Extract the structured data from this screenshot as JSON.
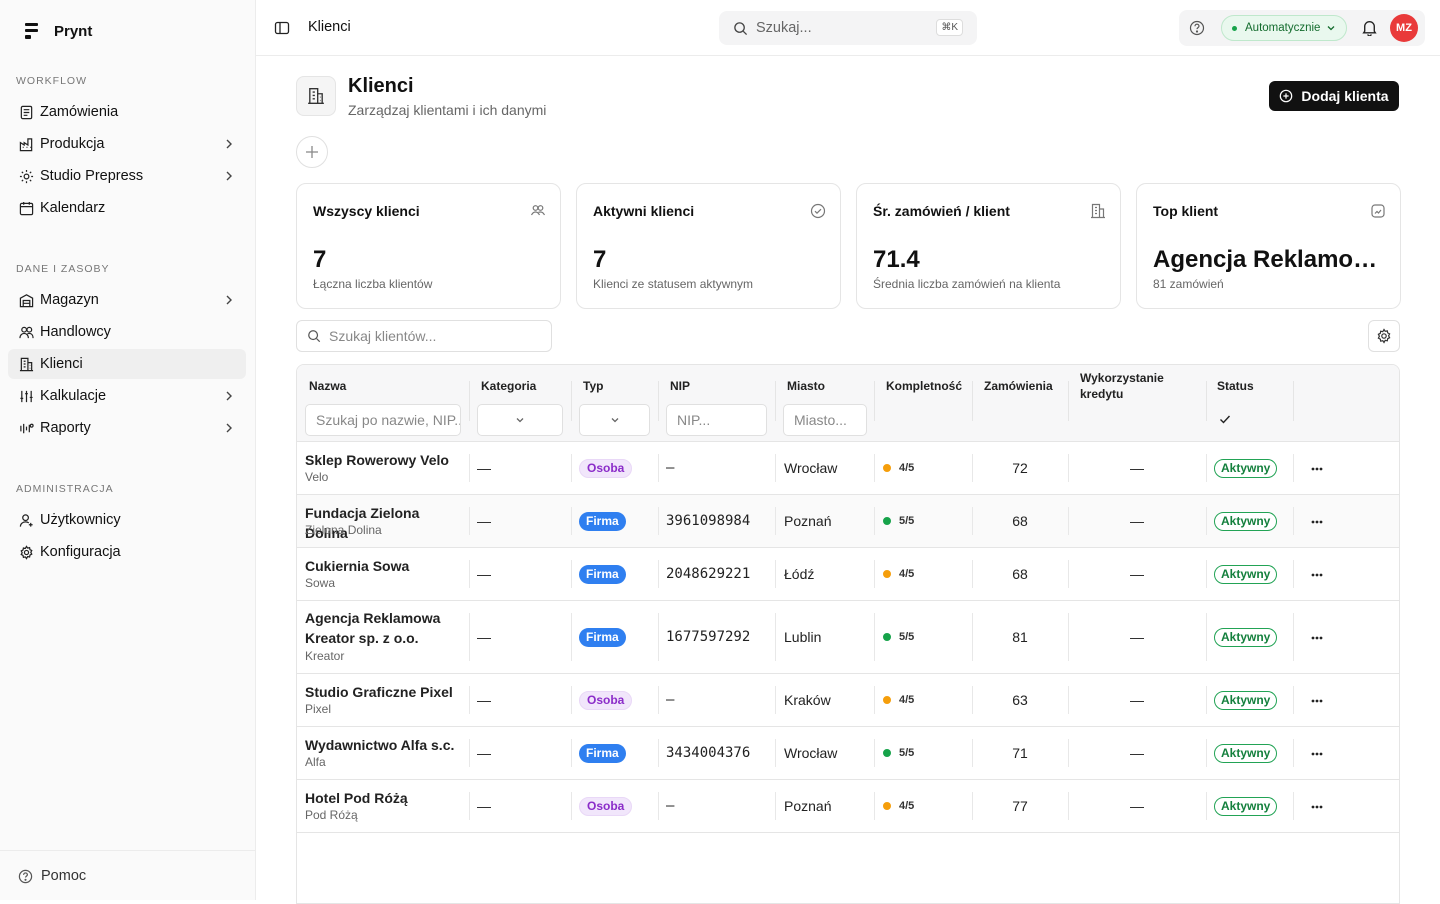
{
  "app": {
    "name": "Prynt"
  },
  "sidebar": {
    "sections": [
      {
        "label": "WORKFLOW",
        "items": [
          {
            "label": "Zamówienia",
            "icon": "orders-icon"
          },
          {
            "label": "Produkcja",
            "icon": "factory-icon",
            "chevron": true
          },
          {
            "label": "Studio Prepress",
            "icon": "studio-icon",
            "chevron": true
          },
          {
            "label": "Kalendarz",
            "icon": "calendar-icon"
          }
        ]
      },
      {
        "label": "DANE I ZASOBY",
        "items": [
          {
            "label": "Magazyn",
            "icon": "warehouse-icon",
            "chevron": true
          },
          {
            "label": "Handlowcy",
            "icon": "sales-icon"
          },
          {
            "label": "Klienci",
            "icon": "building-icon",
            "active": true
          },
          {
            "label": "Kalkulacje",
            "icon": "sliders-icon",
            "chevron": true
          },
          {
            "label": "Raporty",
            "icon": "reports-icon",
            "chevron": true
          }
        ]
      },
      {
        "label": "ADMINISTRACJA",
        "items": [
          {
            "label": "Użytkownicy",
            "icon": "user-icon"
          },
          {
            "label": "Konfiguracja",
            "icon": "gear-icon"
          }
        ]
      }
    ],
    "help": "Pomoc"
  },
  "topbar": {
    "title": "Klienci",
    "search_placeholder": "Szukaj...",
    "shortcut": "⌘K",
    "mode": "Automatycznie",
    "avatar": "MZ"
  },
  "page": {
    "title": "Klienci",
    "subtitle": "Zarządzaj klientami i ich danymi",
    "add_button": "Dodaj klienta"
  },
  "cards": [
    {
      "title": "Wszyscy klienci",
      "value": "7",
      "sub": "Łączna liczba klientów",
      "icon": "users-icon"
    },
    {
      "title": "Aktywni klienci",
      "value": "7",
      "sub": "Klienci ze statusem aktywnym",
      "icon": "check-circle-icon"
    },
    {
      "title": "Śr. zamówień / klient",
      "value": "71.4",
      "sub": "Średnia liczba zamówień na klienta",
      "icon": "building-icon"
    },
    {
      "title": "Top klient",
      "value": "Agencja Reklamowa Kreator sp. z o.o.",
      "sub": "81 zamówień",
      "icon": "chart-box-icon"
    }
  ],
  "table": {
    "search_placeholder": "Szukaj klientów...",
    "columns": {
      "name": "Nazwa",
      "category": "Kategoria",
      "type": "Typ",
      "nip": "NIP",
      "city": "Miasto",
      "completeness": "Kompletność",
      "orders": "Zamówienia",
      "credit": "Wykorzystanie kredytu",
      "status": "Status"
    },
    "filters": {
      "name": "Szukaj po nazwie, NIP...",
      "nip": "NIP...",
      "city": "Miasto..."
    },
    "rows": [
      {
        "name": "Sklep Rowerowy Velo",
        "short": "Velo",
        "category": "—",
        "type": "Osoba",
        "nip": "—",
        "city": "Wrocław",
        "completeness": "4/5",
        "comp_color": "#f59e0b",
        "orders": "72",
        "credit": "—",
        "status": "Aktywny"
      },
      {
        "name": "Fundacja Zielona Dolina",
        "short": "Zielona Dolina",
        "category": "—",
        "type": "Firma",
        "nip": "3961098984",
        "city": "Poznań",
        "completeness": "5/5",
        "comp_color": "#16a34a",
        "orders": "68",
        "credit": "—",
        "status": "Aktywny"
      },
      {
        "name": "Cukiernia Sowa",
        "short": "Sowa",
        "category": "—",
        "type": "Firma",
        "nip": "2048629221",
        "city": "Łódź",
        "completeness": "4/5",
        "comp_color": "#f59e0b",
        "orders": "68",
        "credit": "—",
        "status": "Aktywny"
      },
      {
        "name": "Agencja Reklamowa Kreator sp. z o.o.",
        "short": "Kreator",
        "category": "—",
        "type": "Firma",
        "nip": "1677597292",
        "city": "Lublin",
        "completeness": "5/5",
        "comp_color": "#16a34a",
        "orders": "81",
        "credit": "—",
        "status": "Aktywny"
      },
      {
        "name": "Studio Graficzne Pixel",
        "short": "Pixel",
        "category": "—",
        "type": "Osoba",
        "nip": "—",
        "city": "Kraków",
        "completeness": "4/5",
        "comp_color": "#f59e0b",
        "orders": "63",
        "credit": "—",
        "status": "Aktywny"
      },
      {
        "name": "Wydawnictwo Alfa s.c.",
        "short": "Alfa",
        "category": "—",
        "type": "Firma",
        "nip": "3434004376",
        "city": "Wrocław",
        "completeness": "5/5",
        "comp_color": "#16a34a",
        "orders": "71",
        "credit": "—",
        "status": "Aktywny"
      },
      {
        "name": "Hotel Pod Różą",
        "short": "Pod Różą",
        "category": "—",
        "type": "Osoba",
        "nip": "—",
        "city": "Poznań",
        "completeness": "4/5",
        "comp_color": "#f59e0b",
        "orders": "77",
        "credit": "—",
        "status": "Aktywny"
      }
    ]
  }
}
